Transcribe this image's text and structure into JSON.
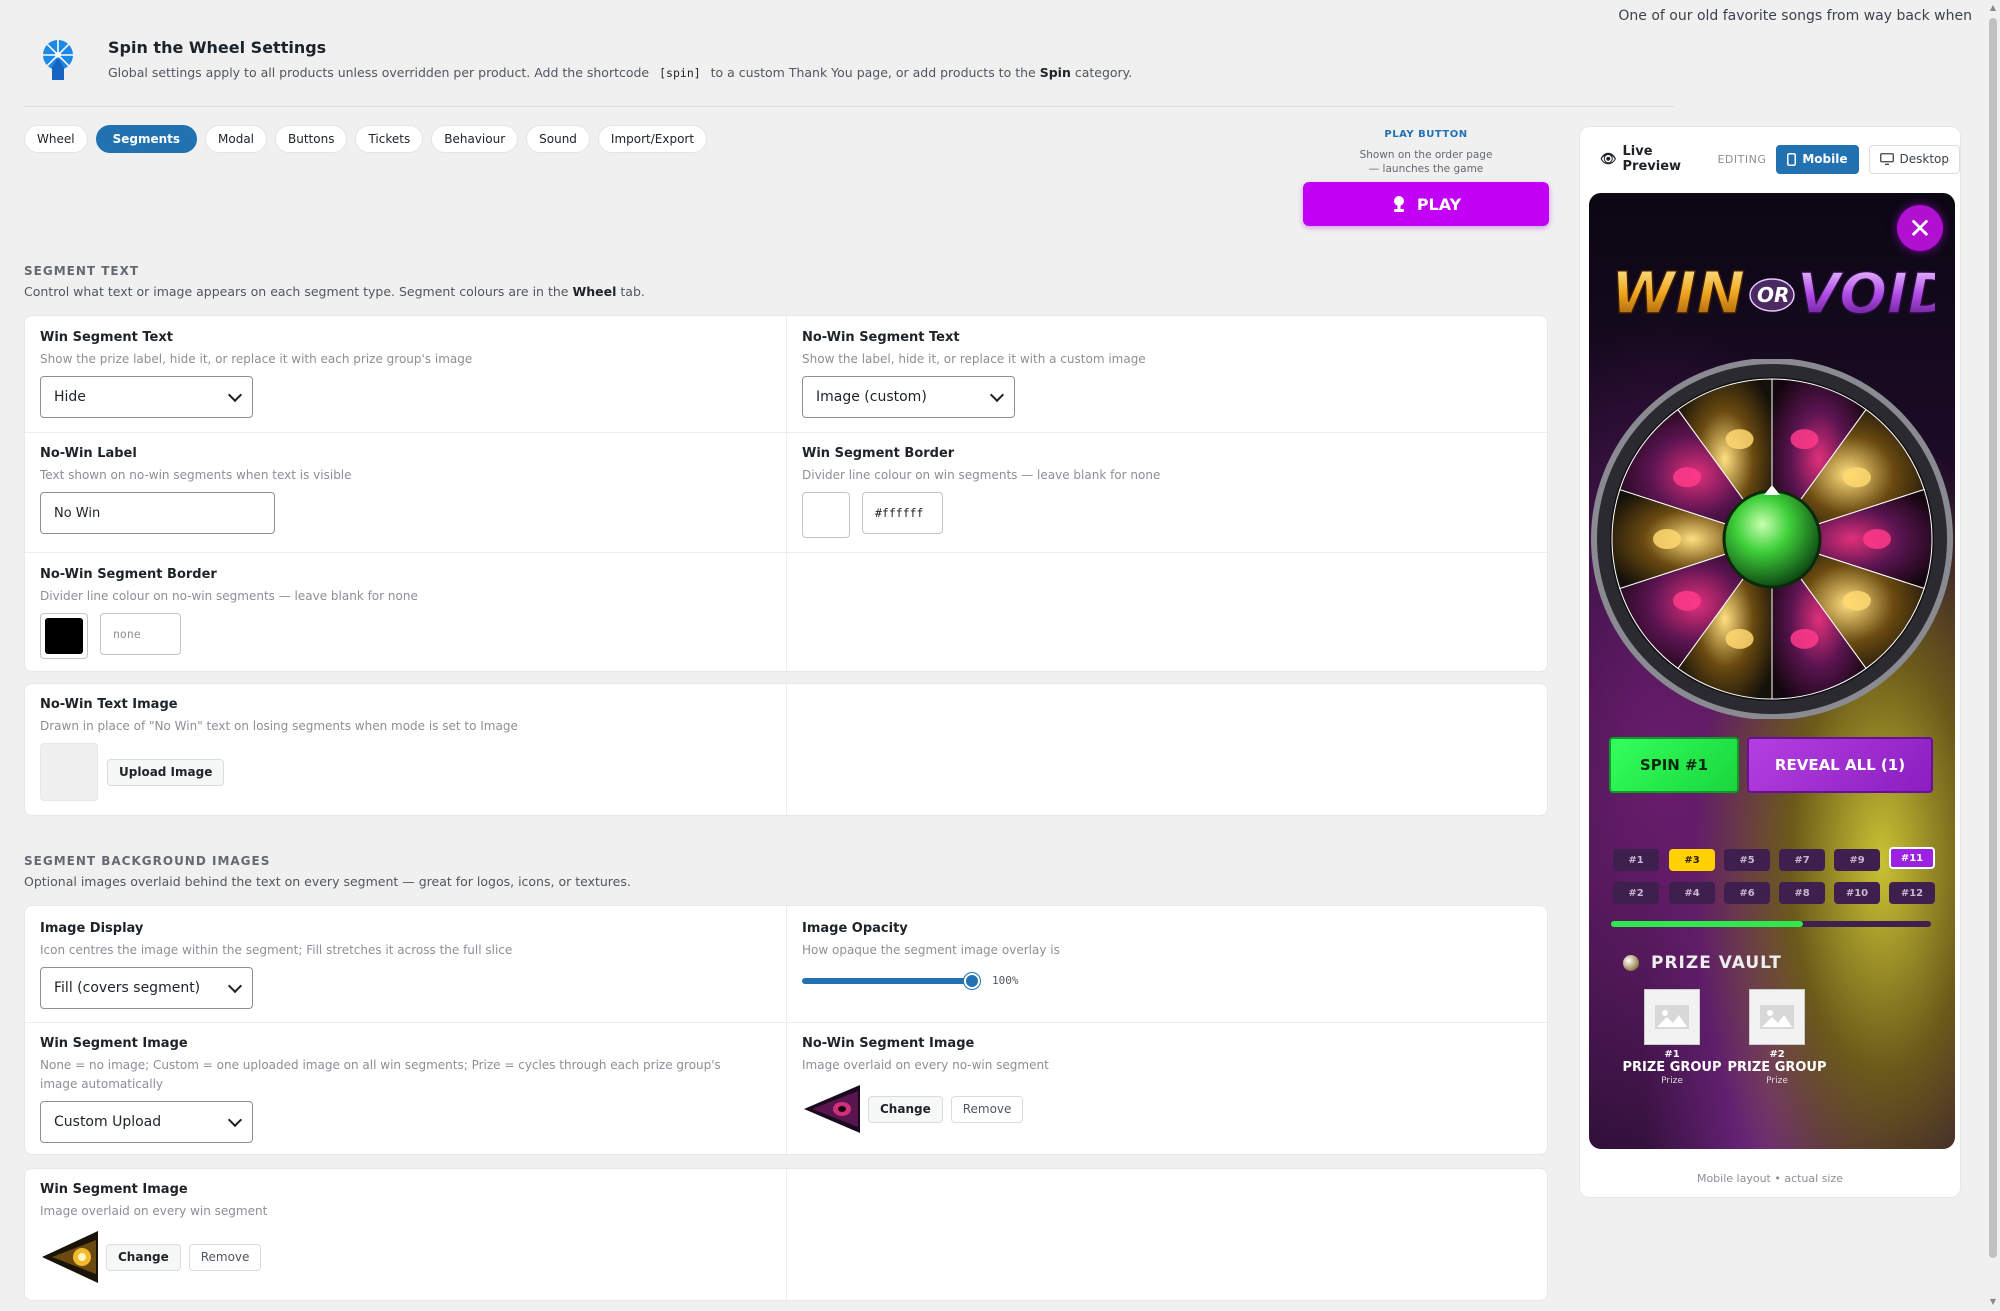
{
  "top_note": "One of our old favorite songs from way back when",
  "header": {
    "icon": "ferris-wheel-icon",
    "title": "Spin the Wheel Settings",
    "desc_a": "Global settings apply to all products unless overridden per product. Add the shortcode",
    "shortcode": "[spin]",
    "desc_b": "to a custom Thank You page, or add products to the",
    "category": "Spin",
    "desc_c": "category."
  },
  "tabs": [
    "Wheel",
    "Segments",
    "Modal",
    "Buttons",
    "Tickets",
    "Behaviour",
    "Sound",
    "Import/Export"
  ],
  "active_tab": "Segments",
  "play": {
    "heading": "PLAY BUTTON",
    "sub1": "Shown on the order page",
    "sub2": "— launches the game",
    "label": "PLAY",
    "color": "#c200f5"
  },
  "segment_text": {
    "heading": "SEGMENT TEXT",
    "desc_a": "Control what text or image appears on each segment type. Segment colours are in the",
    "desc_link": "Wheel",
    "desc_b": "tab.",
    "win_text": {
      "label": "Win Segment Text",
      "help": "Show the prize label, hide it, or replace it with each prize group's image",
      "value": "Hide"
    },
    "nowin_text": {
      "label": "No-Win Segment Text",
      "help": "Show the label, hide it, or replace it with a custom image",
      "value": "Image (custom)"
    },
    "nowin_label": {
      "label": "No-Win Label",
      "help": "Text shown on no-win segments when text is visible",
      "value": "No Win"
    },
    "win_border": {
      "label": "Win Segment Border",
      "help": "Divider line colour on win segments — leave blank for none",
      "value": "#ffffff",
      "swatch": "#ffffff"
    },
    "nowin_border": {
      "label": "No-Win Segment Border",
      "help": "Divider line colour on no-win segments — leave blank for none",
      "placeholder": "none",
      "swatch": "#000000"
    },
    "nowin_image": {
      "label": "No-Win Text Image",
      "help": "Drawn in place of \"No Win\" text on losing segments when mode is set to Image",
      "button": "Upload Image"
    }
  },
  "segment_bg": {
    "heading": "SEGMENT BACKGROUND IMAGES",
    "desc": "Optional images overlaid behind the text on every segment — great for logos, icons, or textures.",
    "display": {
      "label": "Image Display",
      "help": "Icon centres the image within the segment; Fill stretches it across the full slice",
      "value": "Fill (covers segment)"
    },
    "opacity": {
      "label": "Image Opacity",
      "help": "How opaque the segment image overlay is",
      "value": "100%",
      "level": 1.0
    },
    "win_image_mode": {
      "label": "Win Segment Image",
      "help": "None = no image; Custom = one uploaded image on all win segments; Prize = cycles through each prize group's image automatically",
      "value": "Custom Upload"
    },
    "nowin_image": {
      "label": "No-Win Segment Image",
      "help": "Image overlaid on every no-win segment",
      "change": "Change",
      "remove": "Remove"
    },
    "win_image": {
      "label": "Win Segment Image",
      "help": "Image overlaid on every win segment",
      "change": "Change",
      "remove": "Remove"
    }
  },
  "preview": {
    "title": "Live Preview",
    "editing": "EDITING",
    "mobile": "Mobile",
    "desktop": "Desktop",
    "spin_label": "SPIN #1",
    "reveal_label": "REVEAL ALL (1)",
    "tickets_row1": [
      "#1",
      "#3",
      "#5",
      "#7",
      "#9",
      "#11"
    ],
    "tickets_row2": [
      "#2",
      "#4",
      "#6",
      "#8",
      "#10",
      "#12"
    ],
    "highlight_ticket": "#3",
    "selected_ticket": "#11",
    "vault_title": "PRIZE VAULT",
    "prizes": [
      {
        "num": "#1",
        "name": "PRIZE GROUP",
        "sub": "Prize"
      },
      {
        "num": "#2",
        "name": "PRIZE GROUP",
        "sub": "Prize"
      }
    ],
    "footer": "Mobile layout • actual size"
  }
}
